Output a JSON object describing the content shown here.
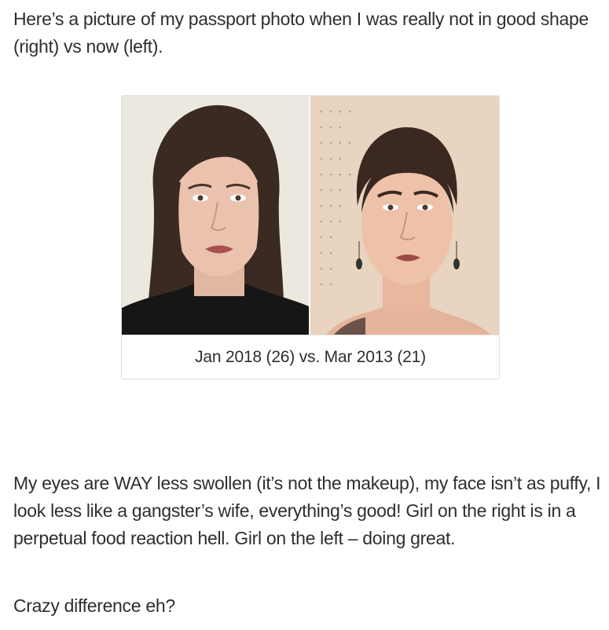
{
  "post": {
    "intro": "Here’s a picture of my passport photo when I was really not in good shape (right) vs now (left).",
    "figure": {
      "caption": "Jan 2018 (26) vs. Mar 2013 (21)",
      "left_photo": "passport-photo-2018",
      "right_photo": "passport-photo-2013"
    },
    "body": "My eyes are WAY less swollen (it’s not the makeup), my face isn’t as puffy, I look less like a gangster’s wife, everything’s good! Girl on the right is in a perpetual food reaction hell. Girl on the left – doing great.",
    "closing": "Crazy difference eh?"
  }
}
